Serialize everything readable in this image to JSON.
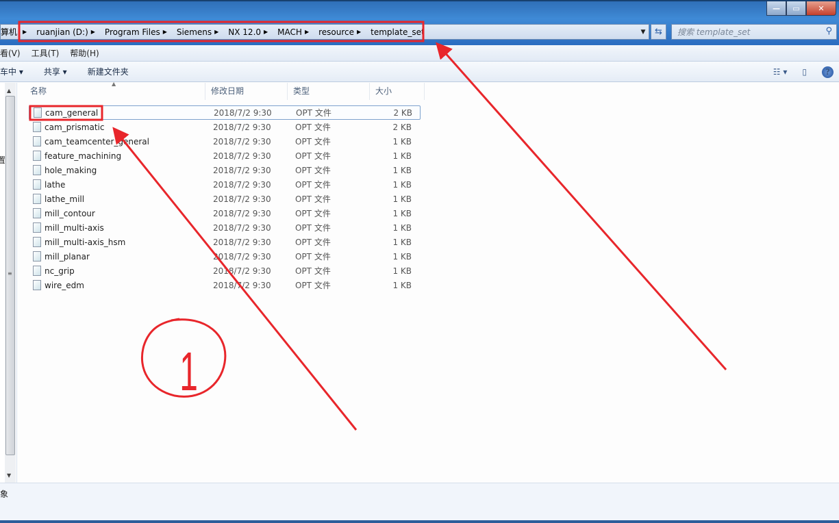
{
  "address": {
    "partial_root": "算机",
    "crumbs": [
      "ruanjian (D:)",
      "Program Files",
      "Siemens",
      "NX 12.0",
      "MACH",
      "resource",
      "template_set"
    ]
  },
  "search": {
    "placeholder": "搜索 template_set"
  },
  "menu": {
    "items": [
      "看(V)",
      "工具(T)",
      "帮助(H)"
    ]
  },
  "toolbar": {
    "include_partial": "车中 ▾",
    "share": "共享 ▾",
    "new_folder": "新建文件夹"
  },
  "columns": [
    "名称",
    "修改日期",
    "类型",
    "大小"
  ],
  "files": [
    {
      "name": "cam_general",
      "date": "2018/7/2 9:30",
      "type": "OPT 文件",
      "size": "2 KB"
    },
    {
      "name": "cam_prismatic",
      "date": "2018/7/2 9:30",
      "type": "OPT 文件",
      "size": "2 KB"
    },
    {
      "name": "cam_teamcenter_general",
      "date": "2018/7/2 9:30",
      "type": "OPT 文件",
      "size": "1 KB"
    },
    {
      "name": "feature_machining",
      "date": "2018/7/2 9:30",
      "type": "OPT 文件",
      "size": "1 KB"
    },
    {
      "name": "hole_making",
      "date": "2018/7/2 9:30",
      "type": "OPT 文件",
      "size": "1 KB"
    },
    {
      "name": "lathe",
      "date": "2018/7/2 9:30",
      "type": "OPT 文件",
      "size": "1 KB"
    },
    {
      "name": "lathe_mill",
      "date": "2018/7/2 9:30",
      "type": "OPT 文件",
      "size": "1 KB"
    },
    {
      "name": "mill_contour",
      "date": "2018/7/2 9:30",
      "type": "OPT 文件",
      "size": "1 KB"
    },
    {
      "name": "mill_multi-axis",
      "date": "2018/7/2 9:30",
      "type": "OPT 文件",
      "size": "1 KB"
    },
    {
      "name": "mill_multi-axis_hsm",
      "date": "2018/7/2 9:30",
      "type": "OPT 文件",
      "size": "1 KB"
    },
    {
      "name": "mill_planar",
      "date": "2018/7/2 9:30",
      "type": "OPT 文件",
      "size": "1 KB"
    },
    {
      "name": "nc_grip",
      "date": "2018/7/2 9:30",
      "type": "OPT 文件",
      "size": "1 KB"
    },
    {
      "name": "wire_edm",
      "date": "2018/7/2 9:30",
      "type": "OPT 文件",
      "size": "1 KB"
    }
  ],
  "nav_partial": "置",
  "status": {
    "text": "象"
  },
  "annotation": {
    "number": "1",
    "color": "#e8262b"
  },
  "icons": {
    "window": [
      "minimize-icon",
      "maximize-icon",
      "close-icon"
    ],
    "refresh": "refresh-icon",
    "search": "search-icon",
    "views": "view-list-icon",
    "preview": "preview-pane-icon",
    "help": "help-icon",
    "file": "document-icon"
  }
}
